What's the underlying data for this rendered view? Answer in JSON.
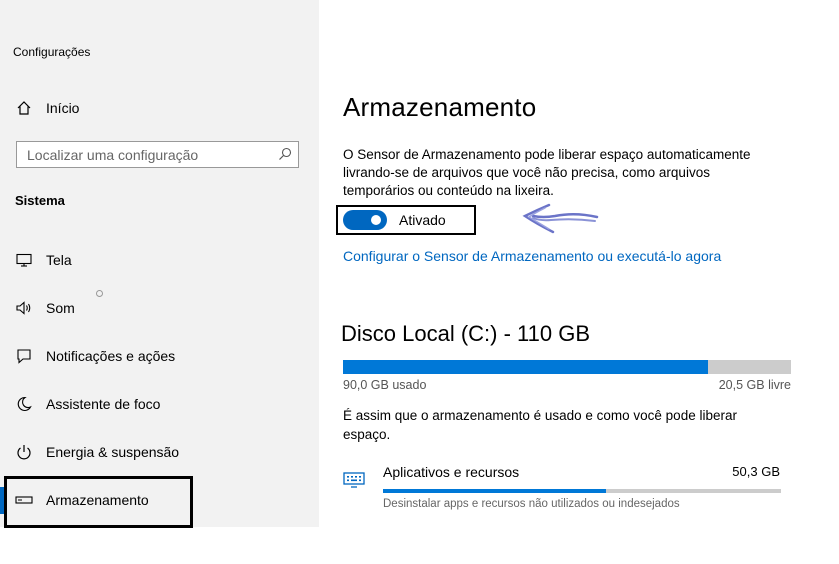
{
  "app": {
    "title": "Configurações"
  },
  "sidebar": {
    "home": "Início",
    "search_placeholder": "Localizar uma configuração",
    "section": "Sistema",
    "items": [
      {
        "label": "Tela",
        "icon": "monitor-icon"
      },
      {
        "label": "Som",
        "icon": "speaker-icon"
      },
      {
        "label": "Notificações e ações",
        "icon": "notification-icon"
      },
      {
        "label": "Assistente de foco",
        "icon": "moon-icon"
      },
      {
        "label": "Energia & suspensão",
        "icon": "power-icon"
      },
      {
        "label": "Armazenamento",
        "icon": "storage-icon"
      }
    ]
  },
  "main": {
    "title": "Armazenamento",
    "description": "O Sensor de Armazenamento pode liberar espaço automaticamente livrando-se de arquivos que você não precisa, como arquivos temporários ou conteúdo na lixeira.",
    "toggle_label": "Ativado",
    "toggle_on": true,
    "link": "Configurar o Sensor de Armazenamento ou executá-lo agora",
    "disk": {
      "title": "Disco Local (C:) - 110 GB",
      "used_label": "90,0 GB usado",
      "free_label": "20,5 GB livre",
      "used_fraction": 0.815
    },
    "usage_description": "É assim que o armazenamento é usado e como você pode liberar espaço.",
    "categories": [
      {
        "name": "Aplicativos e recursos",
        "size": "50,3 GB",
        "description": "Desinstalar apps e recursos não utilizados ou indesejados",
        "fraction": 0.56,
        "icon": "keyboard-icon"
      }
    ]
  },
  "colors": {
    "accent": "#0067c0",
    "sidebar_bg": "#f2f2f2",
    "bar_bg": "#cccccc"
  }
}
